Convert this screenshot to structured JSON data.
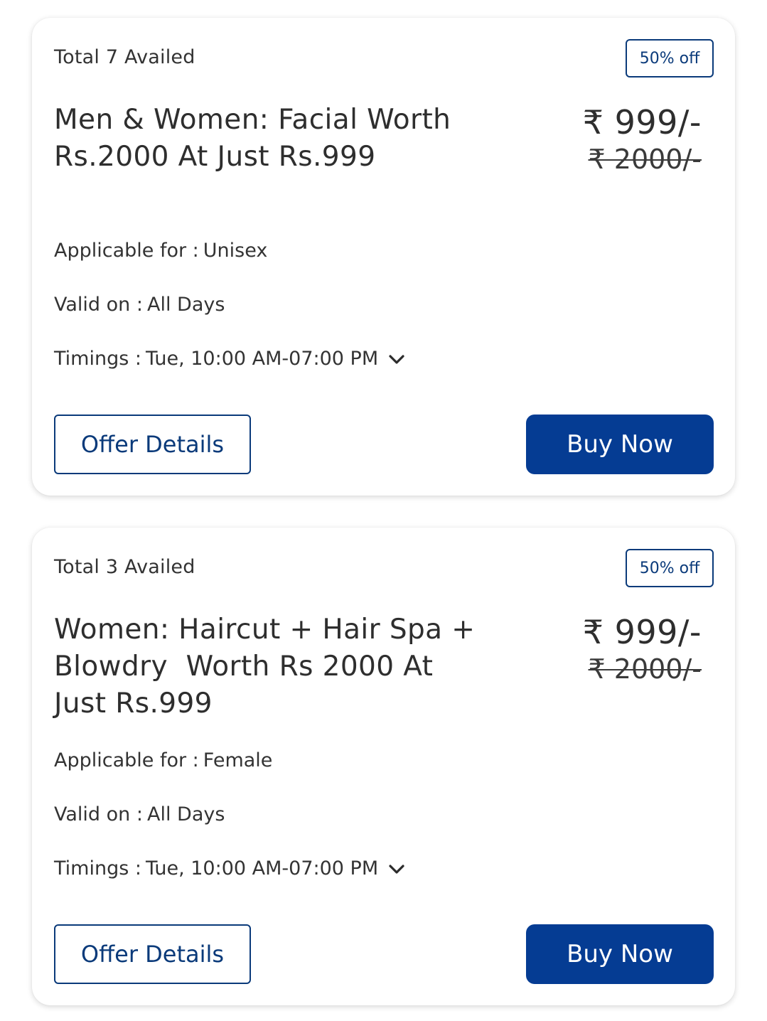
{
  "offers": [
    {
      "availed": "Total 7 Availed",
      "badge": "50% off",
      "title": "Men & Women: Facial Worth Rs.2000 At Just Rs.999",
      "price": "₹ 999/-",
      "original_price": "₹ 2000/-",
      "applicable_label": "Applicable for :",
      "applicable_value": "Unisex",
      "valid_label": "Valid on :",
      "valid_value": "All Days",
      "timings_label": "Timings :",
      "timings_value": "Tue, 10:00 AM-07:00 PM",
      "offer_details_label": "Offer Details",
      "buy_now_label": "Buy Now"
    },
    {
      "availed": "Total 3 Availed",
      "badge": "50% off",
      "title": "Women: Haircut + Hair Spa + Blowdry  Worth Rs 2000 At Just Rs.999",
      "price": "₹ 999/-",
      "original_price": "₹ 2000/-",
      "applicable_label": "Applicable for :",
      "applicable_value": "Female",
      "valid_label": "Valid on :",
      "valid_value": "All Days",
      "timings_label": "Timings :",
      "timings_value": "Tue, 10:00 AM-07:00 PM",
      "offer_details_label": "Offer Details",
      "buy_now_label": "Buy Now"
    }
  ],
  "colors": {
    "primary": "#053c93",
    "outline": "#0a3a7a",
    "text": "#2e2e2e"
  },
  "icons": {
    "timings_toggle": "chevron-down-icon"
  }
}
